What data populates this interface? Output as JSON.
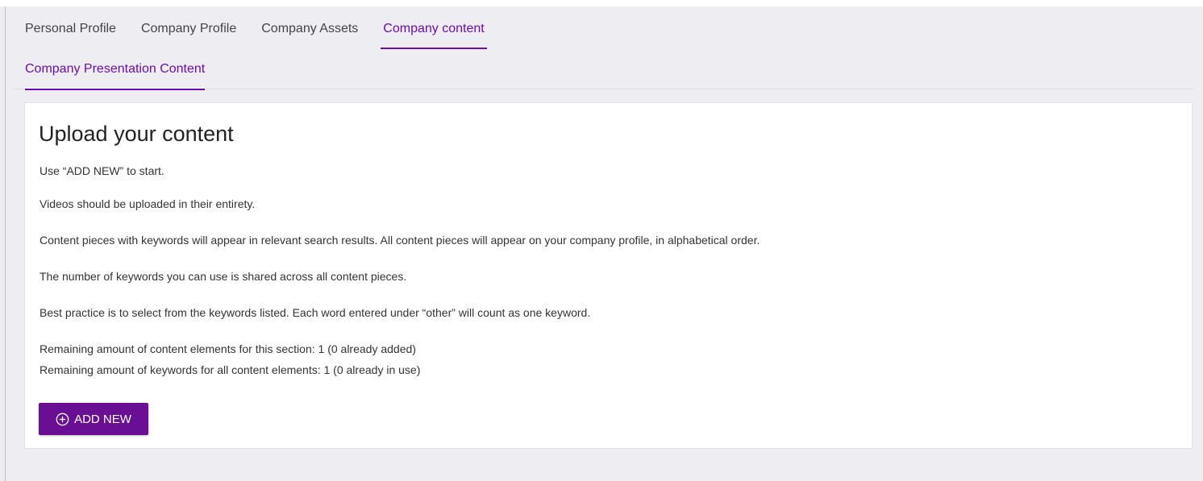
{
  "tabs": [
    {
      "label": "Personal Profile",
      "active": false
    },
    {
      "label": "Company Profile",
      "active": false
    },
    {
      "label": "Company Assets",
      "active": false
    },
    {
      "label": "Company content",
      "active": true
    }
  ],
  "subtabs": [
    {
      "label": "Company Presentation Content",
      "active": true
    }
  ],
  "card": {
    "title": "Upload your content",
    "paragraphs": [
      "Use “ADD NEW” to start.",
      "Videos should be uploaded in their entirety.",
      "Content pieces with keywords will appear in relevant search results. All content pieces will appear on your company profile, in alphabetical order.",
      "The number of keywords you can use is shared across all content pieces.",
      "Best practice is to select from the keywords listed. Each word entered under “other” will count as one keyword.",
      "Remaining amount of content elements for this section: 1 (0 already added)",
      "Remaining amount of keywords for all content elements: 1 (0 already in use)"
    ],
    "add_button": {
      "label": "ADD NEW",
      "icon": "plus-circle-icon"
    }
  },
  "colors": {
    "accent": "#6a0dad",
    "button_bg": "#6a0f93",
    "page_bg": "#eeeef2"
  }
}
